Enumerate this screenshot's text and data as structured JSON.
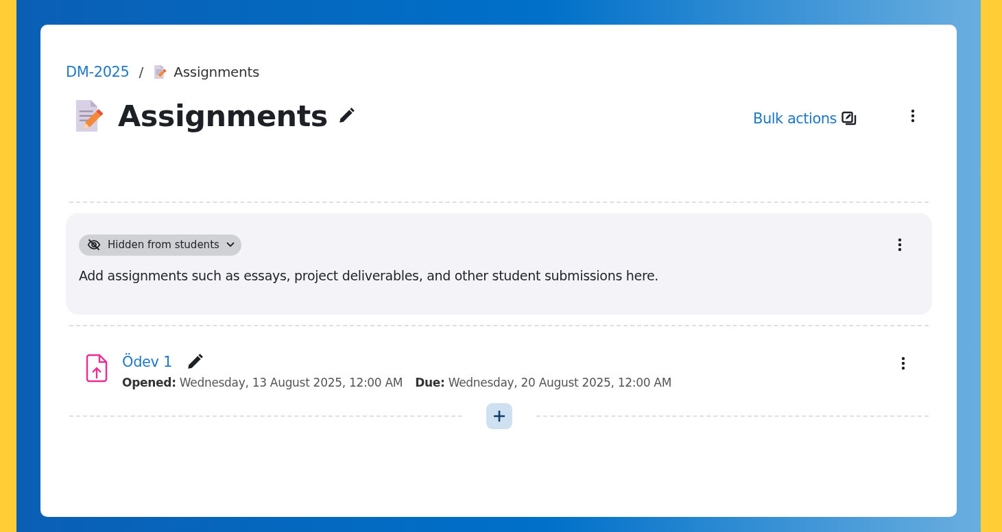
{
  "breadcrumb": [
    {
      "label": "DM-2025",
      "kind": "link"
    },
    {
      "label": "/",
      "kind": "separator"
    },
    {
      "label": "Assignments",
      "kind": "current"
    }
  ],
  "page_title": "Assignments",
  "header_actions": {
    "bulk_actions": "Bulk actions"
  },
  "section": {
    "hidden": true,
    "visibility_badge": "Hidden from students",
    "description": "Add assignments such as essays, project deliverables, and other student submissions here."
  },
  "activities": [
    {
      "name": "Ödev 1",
      "dates": [
        "**Opened:** Wednesday, 13 August 2025, 12:00 AM",
        "**Due:** Wednesday, 20 August 2025, 12:00 AM"
      ]
    }
  ]
}
